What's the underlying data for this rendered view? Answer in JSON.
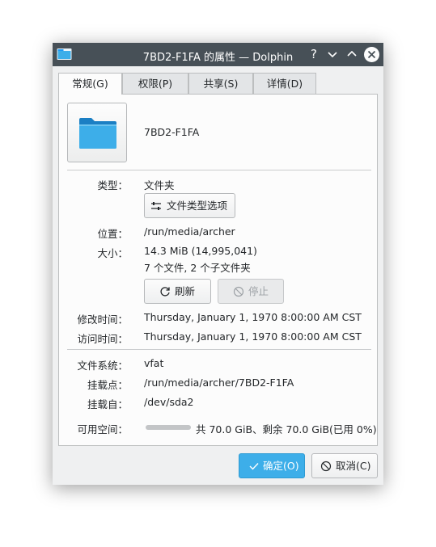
{
  "window": {
    "title": "7BD2-F1FA 的属性 — Dolphin",
    "help_glyph": "?",
    "minimize_glyph": "⌄",
    "maximize_glyph": "⌃"
  },
  "tabs": [
    {
      "label": "常规(G)",
      "active": true
    },
    {
      "label": "权限(P)",
      "active": false
    },
    {
      "label": "共享(S)",
      "active": false
    },
    {
      "label": "详情(D)",
      "active": false
    }
  ],
  "general": {
    "name": "7BD2-F1FA",
    "type_label": "类型：",
    "type_value": "文件夹",
    "type_options_button": "文件类型选项",
    "location_label": "位置：",
    "location_value": "/run/media/archer",
    "size_label": "大小：",
    "size_value": "14.3 MiB (14,995,041)",
    "size_detail": "7 个文件, 2 个子文件夹",
    "refresh_button": "刷新",
    "stop_button": "停止",
    "modified_label": "修改时间：",
    "modified_value": "Thursday, January 1, 1970 8:00:00 AM CST",
    "accessed_label": "访问时间：",
    "accessed_value": "Thursday, January 1, 1970 8:00:00 AM CST",
    "filesystem_label": "文件系统：",
    "filesystem_value": "vfat",
    "mountpoint_label": "挂载点：",
    "mountpoint_value": "/run/media/archer/7BD2-F1FA",
    "mountedfrom_label": "挂载自：",
    "mountedfrom_value": "/dev/sda2",
    "free_label": "可用空间：",
    "free_value": "共 70.0 GiB、剩余 70.0 GiB(已用 0%)",
    "used_fraction": 0
  },
  "footer": {
    "ok_button": "确定(O)",
    "cancel_button": "取消(C)"
  },
  "colors": {
    "titlebar": "#475057",
    "accent": "#3daee9",
    "folder": "#3daee9"
  }
}
